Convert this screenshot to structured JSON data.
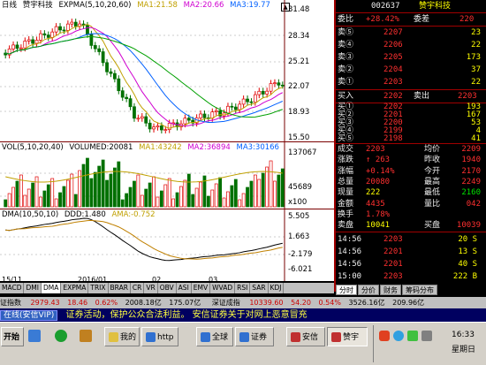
{
  "chart": {
    "price_header": {
      "label": "日线",
      "stock": "赞宇科技",
      "expma": "EXPMA(5,10,20,60)",
      "ma1": "MA1:21.58",
      "ma2": "MA2:20.66",
      "ma3": "MA3:19.77"
    },
    "price_axis": [
      "31.48",
      "28.34",
      "25.21",
      "22.07",
      "18.93",
      "15.50"
    ],
    "vol_header": {
      "vol": "VOL(5,10,20,40)",
      "volumed": "VOLUMED:20081",
      "ma1": "MA1:43242",
      "ma2": "MA2:36894",
      "ma3": "MA3:30166"
    },
    "vol_axis": [
      "137067",
      "45689",
      "x100"
    ],
    "dma_header": {
      "dma": "DMA(10,50,10)",
      "ddd": "DDD:1.480",
      "ama": "AMA:-0.752"
    },
    "dma_axis": [
      "5.505",
      "1.663",
      "-2.179",
      "-6.021"
    ],
    "dates": [
      "15/11",
      "2016/01",
      "02",
      "03"
    ],
    "indicator_tabs": [
      "MACD",
      "DMI",
      "DMA",
      "EXPMA",
      "TRIX",
      "BRAR",
      "CR",
      "VR",
      "OBV",
      "ASI",
      "EMV",
      "WVAD",
      "RSI",
      "SAR",
      "KDJ"
    ]
  },
  "panel": {
    "code": "002637",
    "name": "赞宇科技",
    "weibi": {
      "label": "委比",
      "value": "+28.42%",
      "label2": "委差",
      "value2": "220"
    },
    "sells": [
      {
        "label": "卖⑤",
        "price": "2207",
        "vol": "23"
      },
      {
        "label": "卖④",
        "price": "2206",
        "vol": "22"
      },
      {
        "label": "卖③",
        "price": "2205",
        "vol": "173"
      },
      {
        "label": "卖②",
        "price": "2204",
        "vol": "37"
      },
      {
        "label": "卖①",
        "price": "2203",
        "vol": "22"
      }
    ],
    "buyin": {
      "label": "买入",
      "value": "2202",
      "label2": "卖出",
      "value2": "2203"
    },
    "buys": [
      {
        "label": "买①",
        "price": "2202",
        "vol": "193"
      },
      {
        "label": "买②",
        "price": "2201",
        "vol": "167"
      },
      {
        "label": "买③",
        "price": "2200",
        "vol": "53"
      },
      {
        "label": "买④",
        "price": "2199",
        "vol": "4"
      },
      {
        "label": "买⑤",
        "price": "2198",
        "vol": "41"
      }
    ],
    "stats": [
      {
        "l1": "成交",
        "v1": "2203",
        "l2": "均价",
        "v2": "2209"
      },
      {
        "l1": "涨跌",
        "v1": "↑ 263",
        "l2": "昨收",
        "v2": "1940"
      },
      {
        "l1": "涨幅",
        "v1": "+0.14%",
        "l2": "今开",
        "v2": "2170"
      },
      {
        "l1": "总量",
        "v1": "20080",
        "l2": "最高",
        "v2": "2249"
      },
      {
        "l1": "现量",
        "v1": "222",
        "l2": "最低",
        "v2": "2160"
      },
      {
        "l1": "金额",
        "v1": "4435",
        "l2": "量比",
        "v2": "042"
      },
      {
        "l1": "换手",
        "v1": "1.78%",
        "l2": "",
        "v2": ""
      },
      {
        "l1": "卖盘",
        "v1": "10041",
        "l2": "买盘",
        "v2": "10039"
      }
    ],
    "ticks": [
      {
        "time": "14:56",
        "price": "2203",
        "vol": "20 S"
      },
      {
        "time": "14:56",
        "price": "2201",
        "vol": "13 S"
      },
      {
        "time": "14:56",
        "price": "2201",
        "vol": "40 S"
      },
      {
        "time": "15:00",
        "price": "2203",
        "vol": "222 B"
      }
    ],
    "tabs": [
      "分时",
      "分价",
      "财务",
      "筹码分布"
    ]
  },
  "status": {
    "left": "证指数",
    "v1": "2979.43",
    "v2": "18.46",
    "v3": "0.62%",
    "v4": "2008.18亿",
    "v5": "175.07亿",
    "mid": "深证成指",
    "v6": "10339.60",
    "v7": "54.20",
    "v8": "0.54%",
    "v9": "3526.16亿",
    "v10": "209.96亿"
  },
  "ticker": {
    "button": "在线(安信VIP)",
    "text": "证券活动，保护公众合法利益。    安信证券关于对网上恶意冒充"
  },
  "taskbar": {
    "start": "开始",
    "items": [
      "我的",
      "http",
      "全球",
      "证券",
      "安信",
      "赞宇"
    ],
    "clock": "16:33",
    "day": "星期日"
  },
  "colors": {
    "up": "#ff3030",
    "down": "#00e000",
    "bg": "#000000",
    "accent": "#a00000"
  }
}
